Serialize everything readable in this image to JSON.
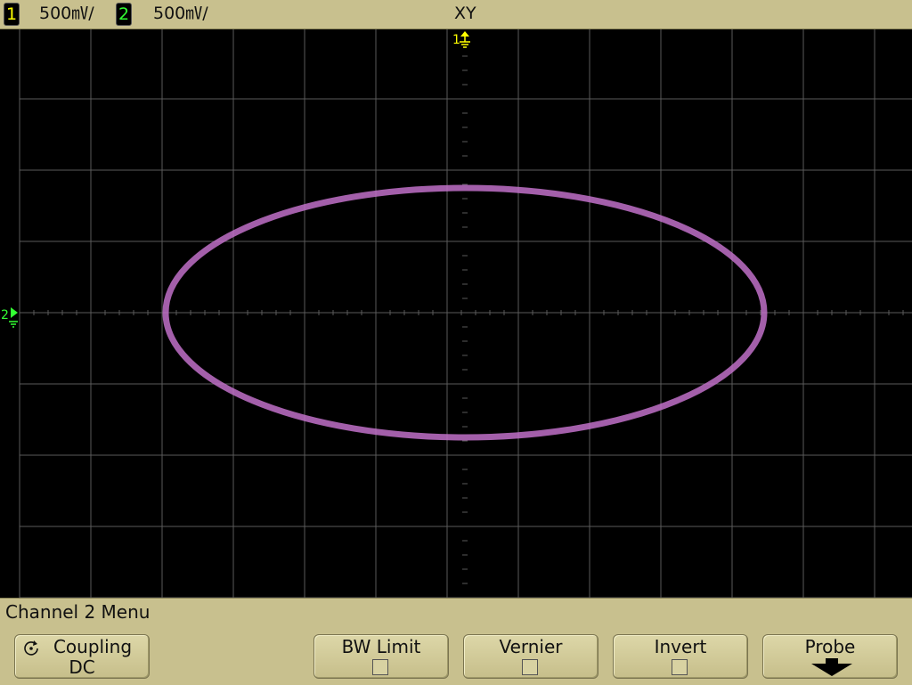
{
  "status_bar": {
    "ch1_number": "1",
    "ch1_scale": "500㎷/",
    "ch2_number": "2",
    "ch2_scale": "500㎷/",
    "mode": "XY"
  },
  "display": {
    "ch1_marker": "1",
    "ch2_marker": "2",
    "trace_color": "#c070c8",
    "grid_color": "#5a5a5a",
    "ch1_color": "#ffff00",
    "ch2_color": "#33ff33",
    "trace": {
      "shape": "ellipse",
      "x_amplitude_div": 4.2,
      "y_amplitude_div": 1.75,
      "x_center_div": 0,
      "y_center_div": 0
    },
    "divisions": {
      "horizontal": 10,
      "vertical": 8
    }
  },
  "menu": {
    "title": "Channel 2  Menu",
    "softkeys": [
      {
        "label": "Coupling",
        "value": "DC",
        "icon": "rotate-selector-icon"
      },
      {
        "label": "BW Limit",
        "checked": false
      },
      {
        "label": "Vernier",
        "checked": false
      },
      {
        "label": "Invert",
        "checked": false
      },
      {
        "label": "Probe",
        "icon": "arrow-down-icon"
      }
    ]
  }
}
